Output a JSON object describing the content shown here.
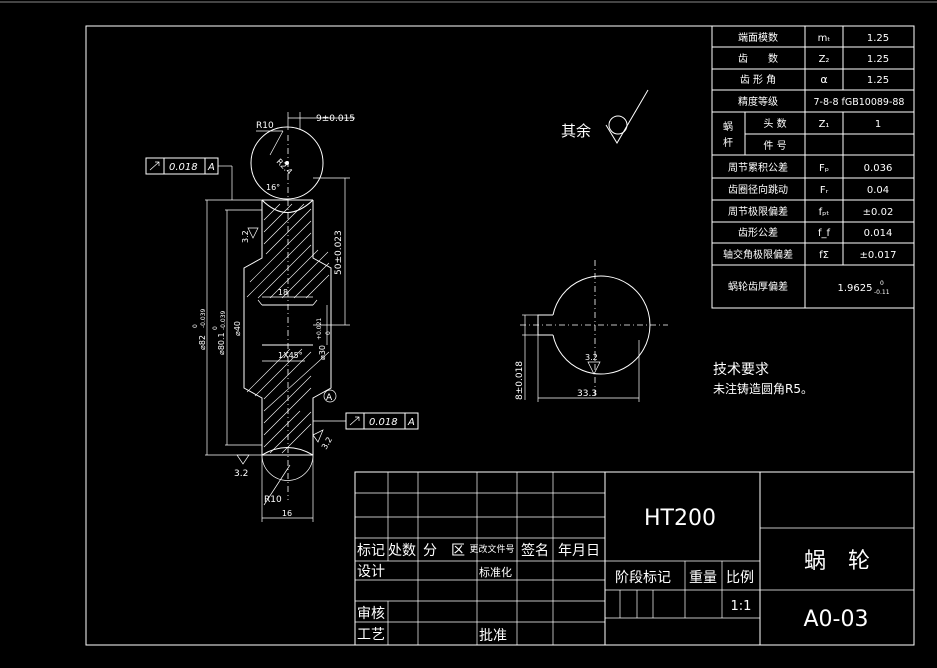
{
  "colors": {
    "background": "#000000",
    "lines": "#ffffff"
  },
  "params_table": [
    {
      "label": "端面模数",
      "symbol": "mₜ",
      "value": "1.25"
    },
    {
      "label": "齿　　数",
      "symbol": "Z₂",
      "value": "1.25"
    },
    {
      "label": "齿 形 角",
      "symbol": "α",
      "value": "1.25"
    },
    {
      "label": "精度等级",
      "symbol": "",
      "value": "7-8-8 fGB10089-88"
    },
    {
      "label": "头 数",
      "symbol": "Z₁",
      "value": "1"
    },
    {
      "label": "件 号",
      "symbol": "",
      "value": ""
    },
    {
      "label": "周节累积公差",
      "symbol": "Fₚ",
      "value": "0.036"
    },
    {
      "label": "齿圈径向跳动",
      "symbol": "Fᵣ",
      "value": "0.04"
    },
    {
      "label": "周节极限偏差",
      "symbol": "fₚₜ",
      "value": "±0.02"
    },
    {
      "label": "齿形公差",
      "symbol": "f_f",
      "value": "0.014"
    },
    {
      "label": "轴交角极限偏差",
      "symbol": "fΣ",
      "value": "±0.017"
    }
  ],
  "worm_group_label": "蜗杆",
  "tooth_thickness": {
    "label": "蜗轮齿厚偏差",
    "value": "1.9625",
    "upper": "0",
    "lower": "-0.11"
  },
  "surface_finish_note": "其余",
  "tech_requirements": {
    "title": "技术要求",
    "text": "未注铸造圆角R5。"
  },
  "dims": {
    "r10_top": "R10",
    "tol_9": "9±0.015",
    "tol_50": "50±0.023",
    "dia_82": "⌀82",
    "dia_82_tol_top": "0",
    "dia_82_tol_bot": "-0.039",
    "dia_80": "⌀80.1",
    "dia_80_tol_top": "0",
    "dia_80_tol_bot": "-0.039",
    "dia_40": "⌀40",
    "dia_30": "⌀30",
    "dia_30_tol_top": "+0.021",
    "dia_30_tol_bot": "0",
    "r2_4": "R2.4",
    "angle_16": "16°",
    "dim_18": "18",
    "chamfer": "1X45°",
    "ra_3_2": "3.2",
    "dim_16": "16",
    "r10_bot": "R10",
    "datum": "A",
    "gtol_value": "0.018",
    "tol_8": "8±0.018",
    "dim_33_3": "33.3"
  },
  "title_block": {
    "material": "HT200",
    "part_name": "蜗　轮",
    "drawing_no": "A0-03",
    "scale_value": "1:1",
    "headers": {
      "mark": "标记",
      "count": "处数",
      "zone": "分　区",
      "change_doc": "更改文件号",
      "sign": "签名",
      "date": "年月日"
    },
    "design": "设计",
    "standardize": "标准化",
    "review": "审核",
    "process": "工艺",
    "approve": "批准",
    "stage_mark": "阶段标记",
    "weight": "重量",
    "scale": "比例"
  }
}
